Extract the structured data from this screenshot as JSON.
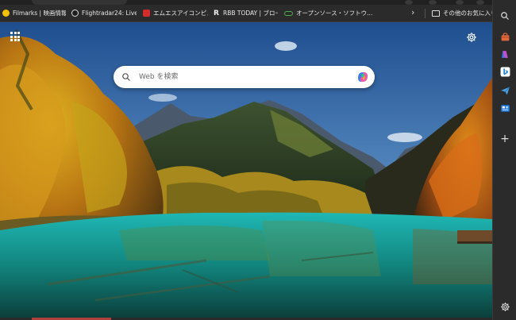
{
  "favorites": [
    {
      "label": "Filmarks | 映画情報...",
      "icon": "filmarks-icon",
      "color": "#f2c200"
    },
    {
      "label": "Flightradar24: Live F...",
      "icon": "flightradar-icon",
      "color": "#e8e8e8"
    },
    {
      "label": "エムエスアイコンピューター...",
      "icon": "msi-icon",
      "color": "#d42b2b"
    },
    {
      "label": "RBB TODAY | ブロード...",
      "icon": "rbb-icon",
      "color": "#222222"
    },
    {
      "label": "オープンソース・ソフトウ...",
      "icon": "osdn-icon",
      "color": "#4caf50"
    }
  ],
  "other_favorites": "その他のお気に入り",
  "search": {
    "placeholder": "Web を検索"
  },
  "colors": {
    "accent": "#0078d4",
    "copilot": "#3b7bf0"
  }
}
